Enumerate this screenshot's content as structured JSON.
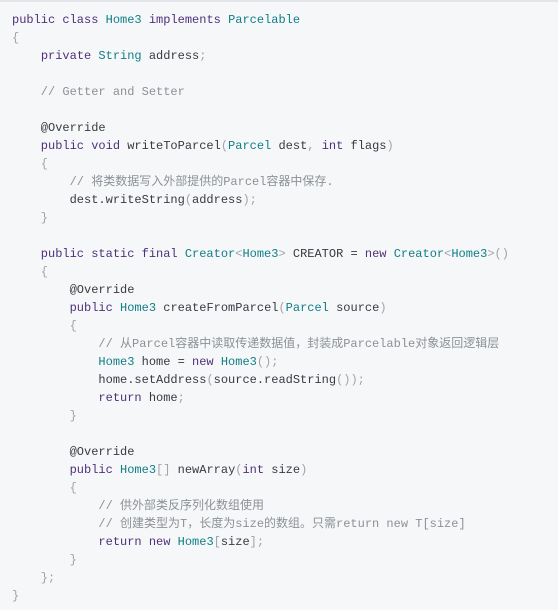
{
  "code": {
    "language": "java",
    "colors": {
      "background": "#f6f7f9",
      "keyword": "#50307a",
      "type": "#0e7f86",
      "comment": "#8c9196",
      "punctuation": "#a0a4a8",
      "plain": "#383a42"
    },
    "lines": [
      [
        [
          "kw",
          "public class "
        ],
        [
          "ty",
          "Home3"
        ],
        [
          "kw",
          " implements "
        ],
        [
          "ty",
          "Parcelable"
        ]
      ],
      [
        [
          "pn",
          "{"
        ]
      ],
      [
        [
          "id",
          "    "
        ],
        [
          "kw",
          "private "
        ],
        [
          "ty",
          "String"
        ],
        [
          "id",
          " address"
        ],
        [
          "pn",
          ";"
        ]
      ],
      [],
      [
        [
          "cm",
          "    // Getter and Setter"
        ]
      ],
      [],
      [
        [
          "an",
          "    @Override"
        ]
      ],
      [
        [
          "kw",
          "    public void "
        ],
        [
          "id",
          "writeToParcel"
        ],
        [
          "pn",
          "("
        ],
        [
          "ty",
          "Parcel"
        ],
        [
          "id",
          " dest"
        ],
        [
          "pn",
          ", "
        ],
        [
          "kw",
          "int"
        ],
        [
          "id",
          " flags"
        ],
        [
          "pn",
          ")"
        ]
      ],
      [
        [
          "pn",
          "    {"
        ]
      ],
      [
        [
          "cm",
          "        // 将类数据写入外部提供的Parcel容器中保存."
        ]
      ],
      [
        [
          "id",
          "        dest.writeString"
        ],
        [
          "pn",
          "("
        ],
        [
          "id",
          "address"
        ],
        [
          "pn",
          ");"
        ]
      ],
      [
        [
          "pn",
          "    }"
        ]
      ],
      [],
      [
        [
          "kw",
          "    public static final "
        ],
        [
          "ty",
          "Creator"
        ],
        [
          "pn",
          "<"
        ],
        [
          "ty",
          "Home3"
        ],
        [
          "pn",
          "> "
        ],
        [
          "id",
          "CREATOR = "
        ],
        [
          "kw",
          "new "
        ],
        [
          "ty",
          "Creator"
        ],
        [
          "pn",
          "<"
        ],
        [
          "ty",
          "Home3"
        ],
        [
          "pn",
          ">()"
        ]
      ],
      [
        [
          "pn",
          "    {"
        ]
      ],
      [
        [
          "an",
          "        @Override"
        ]
      ],
      [
        [
          "kw",
          "        public "
        ],
        [
          "ty",
          "Home3"
        ],
        [
          "id",
          " createFromParcel"
        ],
        [
          "pn",
          "("
        ],
        [
          "ty",
          "Parcel"
        ],
        [
          "id",
          " source"
        ],
        [
          "pn",
          ")"
        ]
      ],
      [
        [
          "pn",
          "        {"
        ]
      ],
      [
        [
          "cm",
          "            // 从Parcel容器中读取传递数据值，封装成Parcelable对象返回逻辑层"
        ]
      ],
      [
        [
          "ty",
          "            Home3"
        ],
        [
          "id",
          " home = "
        ],
        [
          "kw",
          "new "
        ],
        [
          "ty",
          "Home3"
        ],
        [
          "pn",
          "();"
        ]
      ],
      [
        [
          "id",
          "            home.setAddress"
        ],
        [
          "pn",
          "("
        ],
        [
          "id",
          "source.readString"
        ],
        [
          "pn",
          "());"
        ]
      ],
      [
        [
          "kw",
          "            return"
        ],
        [
          "id",
          " home"
        ],
        [
          "pn",
          ";"
        ]
      ],
      [
        [
          "pn",
          "        }"
        ]
      ],
      [],
      [
        [
          "an",
          "        @Override"
        ]
      ],
      [
        [
          "kw",
          "        public "
        ],
        [
          "ty",
          "Home3"
        ],
        [
          "pn",
          "[]"
        ],
        [
          "id",
          " newArray"
        ],
        [
          "pn",
          "("
        ],
        [
          "kw",
          "int"
        ],
        [
          "id",
          " size"
        ],
        [
          "pn",
          ")"
        ]
      ],
      [
        [
          "pn",
          "        {"
        ]
      ],
      [
        [
          "cm",
          "            // 供外部类反序列化数组使用"
        ]
      ],
      [
        [
          "cm",
          "            // 创建类型为T，长度为size的数组。只需return new T[size]"
        ]
      ],
      [
        [
          "kw",
          "            return new "
        ],
        [
          "ty",
          "Home3"
        ],
        [
          "pn",
          "["
        ],
        [
          "id",
          "size"
        ],
        [
          "pn",
          "];"
        ]
      ],
      [
        [
          "pn",
          "        }"
        ]
      ],
      [
        [
          "pn",
          "    };"
        ]
      ],
      [
        [
          "pn",
          "}"
        ]
      ]
    ]
  }
}
